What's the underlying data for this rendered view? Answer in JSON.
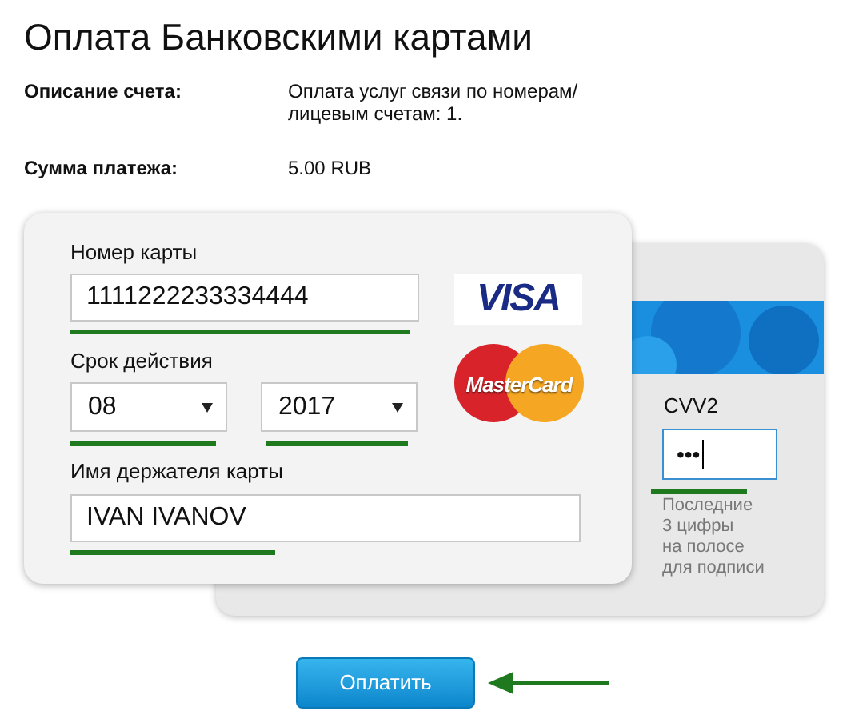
{
  "title": "Оплата Банковскими картами",
  "details": [
    {
      "label": "Описание счета:",
      "value_lines": [
        "Оплата услуг связи по номерам/",
        "лицевым счетам: 1."
      ]
    },
    {
      "label": "Сумма платежа:",
      "value_lines": [
        "5.00 RUB"
      ]
    }
  ],
  "card": {
    "number": {
      "label": "Номер карты",
      "value": "1111222233334444",
      "highlighted": true
    },
    "expiry": {
      "label": "Срок действия",
      "month": {
        "value": "08",
        "highlighted": true
      },
      "year": {
        "value": "2017",
        "highlighted": true
      }
    },
    "holder": {
      "label": "Имя держателя карты",
      "value": "IVAN IVANOV",
      "highlighted": true
    },
    "brands": [
      {
        "kind": "visa",
        "text": "VISA"
      },
      {
        "kind": "mastercard",
        "text": "MasterCard"
      }
    ]
  },
  "cvv": {
    "label": "CVV2",
    "value": "•••",
    "focused": true,
    "highlighted": true,
    "hint_lines": [
      "Последние",
      "3 цифры",
      "на полосе",
      "для подписи"
    ]
  },
  "pay_button": {
    "label": "Оплатить",
    "pointed": true
  }
}
